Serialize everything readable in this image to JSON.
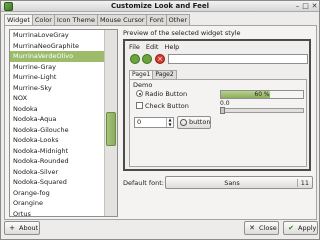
{
  "window": {
    "title": "Customize Look and Feel"
  },
  "tabs": [
    "Widget",
    "Color",
    "Icon Theme",
    "Mouse Cursor",
    "Font",
    "Other"
  ],
  "theme_list": {
    "items": [
      "MurrinaLoveGray",
      "MurrinaNeoGraphite",
      "MurrinaVerdeOlivo",
      "Murrine-Gray",
      "Murrine-Light",
      "Murrine-Sky",
      "NOX",
      "Nodoka",
      "Nodoka-Aqua",
      "Nodoka-Gilouche",
      "Nodoka-Looks",
      "Nodoka-Midnight",
      "Nodoka-Rounded",
      "Nodoka-Silver",
      "Nodoka-Squared",
      "Orange-fog",
      "Orangine",
      "Ortus"
    ],
    "selected_index": 2
  },
  "preview": {
    "label": "Preview of the selected widget style",
    "menu": [
      "File",
      "Edit",
      "Help"
    ],
    "tabs": [
      "Page1",
      "Page2"
    ],
    "demo_label": "Demo",
    "radio_label": "Radio Button",
    "check_label": "Check Button",
    "spin_value": "0",
    "button_label": "button",
    "progress_text": "60 %",
    "progress_fraction": 0.6,
    "scale_value": "0.0"
  },
  "font": {
    "label": "Default font:",
    "name": "Sans",
    "size": "11"
  },
  "buttons": {
    "about": "About",
    "close": "Close",
    "apply": "Apply"
  },
  "colors": {
    "accent": "#9cbc6c",
    "stop": "#d43a2a"
  }
}
